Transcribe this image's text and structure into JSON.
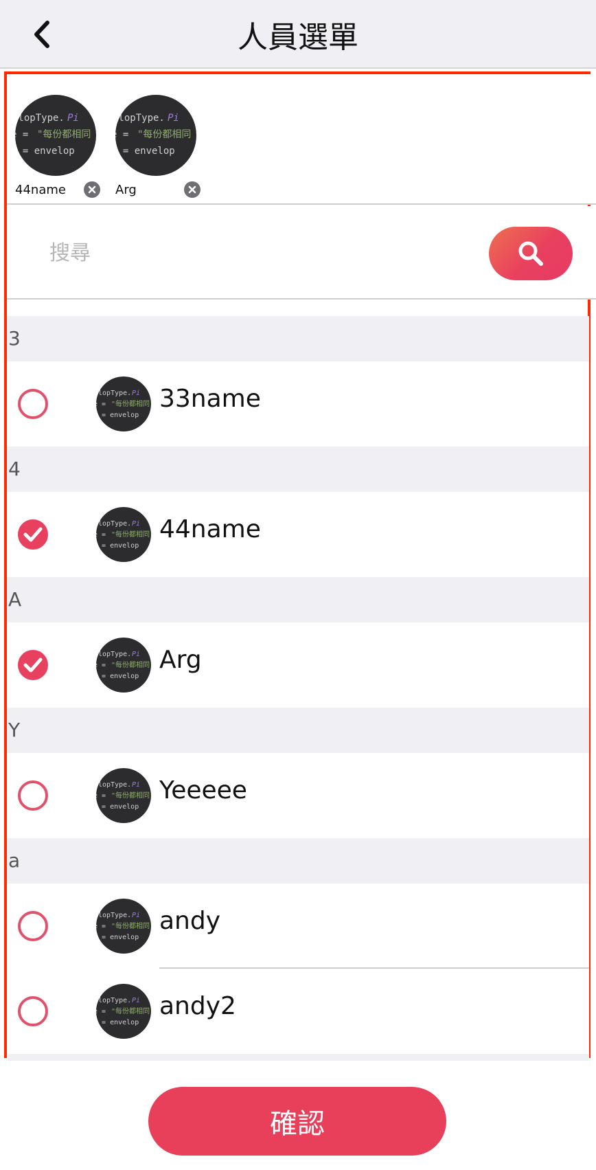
{
  "header": {
    "title": "人員選單",
    "back_icon": "chevron-left-icon"
  },
  "selected": [
    {
      "name": "44name",
      "remove_icon": "close-circle-icon"
    },
    {
      "name": "Arg",
      "remove_icon": "close-circle-icon"
    }
  ],
  "search": {
    "placeholder": "搜尋",
    "value": "",
    "button_icon": "search-icon"
  },
  "sections": [
    {
      "letter": "3",
      "members": [
        {
          "name": "33name",
          "checked": false
        }
      ]
    },
    {
      "letter": "4",
      "members": [
        {
          "name": "44name",
          "checked": true
        }
      ]
    },
    {
      "letter": "A",
      "members": [
        {
          "name": "Arg",
          "checked": true
        }
      ]
    },
    {
      "letter": "Y",
      "members": [
        {
          "name": "Yeeeee",
          "checked": false
        }
      ]
    },
    {
      "letter": "a",
      "members": [
        {
          "name": "andy",
          "checked": false
        },
        {
          "name": "andy2",
          "checked": false
        }
      ]
    }
  ],
  "confirm": {
    "label": "確認"
  },
  "colors": {
    "accent": "#e8405f",
    "frame": "#ff2a00",
    "header_bg": "#efeff4",
    "avatar_bg": "#2c2c2e"
  }
}
